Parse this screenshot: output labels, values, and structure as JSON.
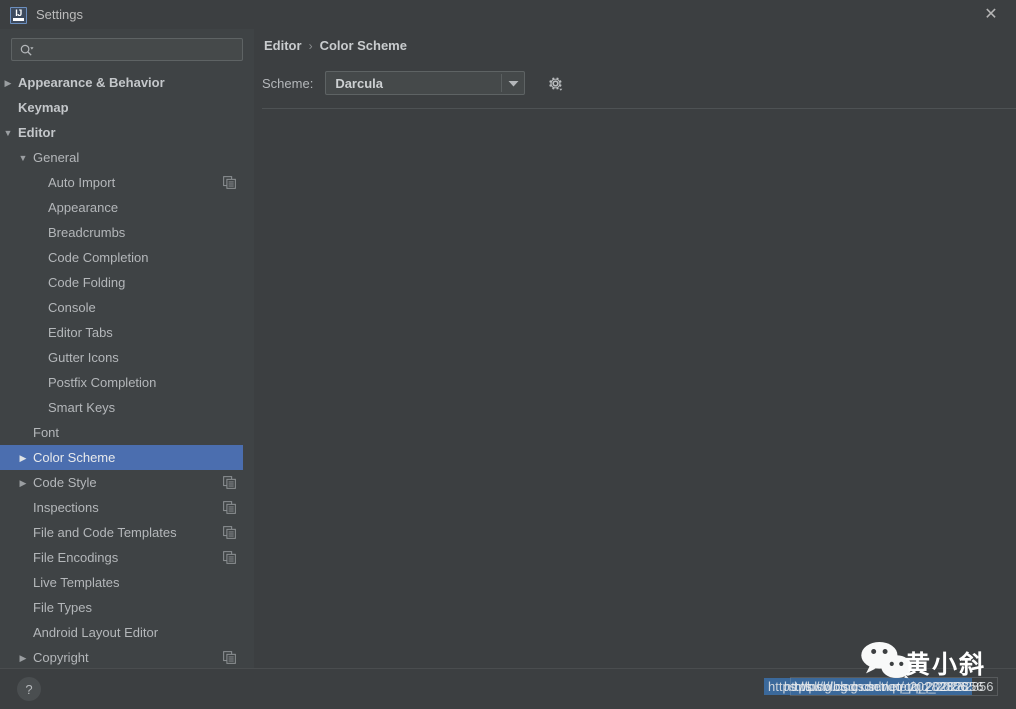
{
  "window": {
    "title": "Settings",
    "logo_icon": "intellij-idea-logo",
    "logo_text": "IJ",
    "close_icon": "close-icon",
    "close_glyph": "✕"
  },
  "search": {
    "icon": "search-icon",
    "value": "",
    "placeholder": ""
  },
  "sidebar": {
    "items": [
      {
        "label": "Appearance & Behavior",
        "indent": 0,
        "arrow": "collapsed",
        "bold": true,
        "badge": false,
        "selected": false
      },
      {
        "label": "Keymap",
        "indent": 0,
        "arrow": "none",
        "bold": true,
        "badge": false,
        "selected": false
      },
      {
        "label": "Editor",
        "indent": 0,
        "arrow": "expanded",
        "bold": true,
        "badge": false,
        "selected": false
      },
      {
        "label": "General",
        "indent": 1,
        "arrow": "expanded",
        "bold": false,
        "badge": false,
        "selected": false
      },
      {
        "label": "Auto Import",
        "indent": 2,
        "arrow": "none",
        "bold": false,
        "badge": true,
        "selected": false
      },
      {
        "label": "Appearance",
        "indent": 2,
        "arrow": "none",
        "bold": false,
        "badge": false,
        "selected": false
      },
      {
        "label": "Breadcrumbs",
        "indent": 2,
        "arrow": "none",
        "bold": false,
        "badge": false,
        "selected": false
      },
      {
        "label": "Code Completion",
        "indent": 2,
        "arrow": "none",
        "bold": false,
        "badge": false,
        "selected": false
      },
      {
        "label": "Code Folding",
        "indent": 2,
        "arrow": "none",
        "bold": false,
        "badge": false,
        "selected": false
      },
      {
        "label": "Console",
        "indent": 2,
        "arrow": "none",
        "bold": false,
        "badge": false,
        "selected": false
      },
      {
        "label": "Editor Tabs",
        "indent": 2,
        "arrow": "none",
        "bold": false,
        "badge": false,
        "selected": false
      },
      {
        "label": "Gutter Icons",
        "indent": 2,
        "arrow": "none",
        "bold": false,
        "badge": false,
        "selected": false
      },
      {
        "label": "Postfix Completion",
        "indent": 2,
        "arrow": "none",
        "bold": false,
        "badge": false,
        "selected": false
      },
      {
        "label": "Smart Keys",
        "indent": 2,
        "arrow": "none",
        "bold": false,
        "badge": false,
        "selected": false
      },
      {
        "label": "Font",
        "indent": 1,
        "arrow": "none",
        "bold": false,
        "badge": false,
        "selected": false
      },
      {
        "label": "Color Scheme",
        "indent": 1,
        "arrow": "collapsed",
        "bold": false,
        "badge": false,
        "selected": true
      },
      {
        "label": "Code Style",
        "indent": 1,
        "arrow": "collapsed",
        "bold": false,
        "badge": true,
        "selected": false
      },
      {
        "label": "Inspections",
        "indent": 1,
        "arrow": "none",
        "bold": false,
        "badge": true,
        "selected": false
      },
      {
        "label": "File and Code Templates",
        "indent": 1,
        "arrow": "none",
        "bold": false,
        "badge": true,
        "selected": false
      },
      {
        "label": "File Encodings",
        "indent": 1,
        "arrow": "none",
        "bold": false,
        "badge": true,
        "selected": false
      },
      {
        "label": "Live Templates",
        "indent": 1,
        "arrow": "none",
        "bold": false,
        "badge": false,
        "selected": false
      },
      {
        "label": "File Types",
        "indent": 1,
        "arrow": "none",
        "bold": false,
        "badge": false,
        "selected": false
      },
      {
        "label": "Android Layout Editor",
        "indent": 1,
        "arrow": "none",
        "bold": false,
        "badge": false,
        "selected": false
      },
      {
        "label": "Copyright",
        "indent": 1,
        "arrow": "collapsed",
        "bold": false,
        "badge": true,
        "selected": false
      }
    ],
    "scrollbar": "vertical-scrollbar"
  },
  "content": {
    "breadcrumb": {
      "parent": "Editor",
      "separator": "›",
      "current": "Color Scheme"
    },
    "scheme": {
      "label": "Scheme:",
      "value": "Darcula",
      "dropdown_icon": "chevron-down-icon",
      "gear_icon": "gear-icon"
    }
  },
  "bottom": {
    "help_label": "?",
    "help_icon": "help-icon"
  },
  "watermark": {
    "wechat_icon": "wechat-logo",
    "brand": "黄小斜",
    "url_primary": "https://blog.csdn.net/qq_20282856",
    "url_secondary": "https://blog.csdn.net/qq_20282856",
    "url_tertiary": "https://blog.csdn.net/qq_20282856"
  },
  "colors": {
    "window_bg": "#3c3f41",
    "sidebar_bg": "#3f4345",
    "selection": "#4b6eaf",
    "text": "#b4b7ba",
    "border": "#5e6364",
    "logo_blue": "#3e4b5e"
  }
}
